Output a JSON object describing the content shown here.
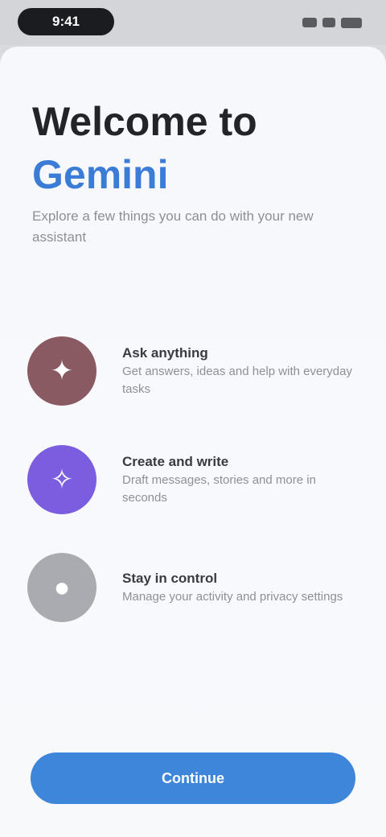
{
  "status_bar": {
    "time": "9:41",
    "icons": [
      "signal-icon",
      "wifi-icon",
      "battery-icon"
    ]
  },
  "header": {
    "title_line1": "Welcome to",
    "title_line2": "Gemini",
    "subtitle": "Explore a few things you can do with your new assistant"
  },
  "features": [
    {
      "icon": "chat-icon",
      "glyph": "✦",
      "color": "#8a5a63",
      "title": "Ask anything",
      "description": "Get answers, ideas and help with everyday tasks"
    },
    {
      "icon": "sparkle-icon",
      "glyph": "✧",
      "color": "#7b5de0",
      "title": "Create and write",
      "description": "Draft messages, stories and more in seconds"
    },
    {
      "icon": "lock-icon",
      "glyph": "●",
      "color": "#a9abb0",
      "title": "Stay in control",
      "description": "Manage your activity and privacy settings"
    }
  ],
  "cta": {
    "label": "Continue",
    "color": "#3d86da"
  },
  "colors": {
    "accent": "#3b7dd6",
    "background": "#f6f8fb"
  }
}
